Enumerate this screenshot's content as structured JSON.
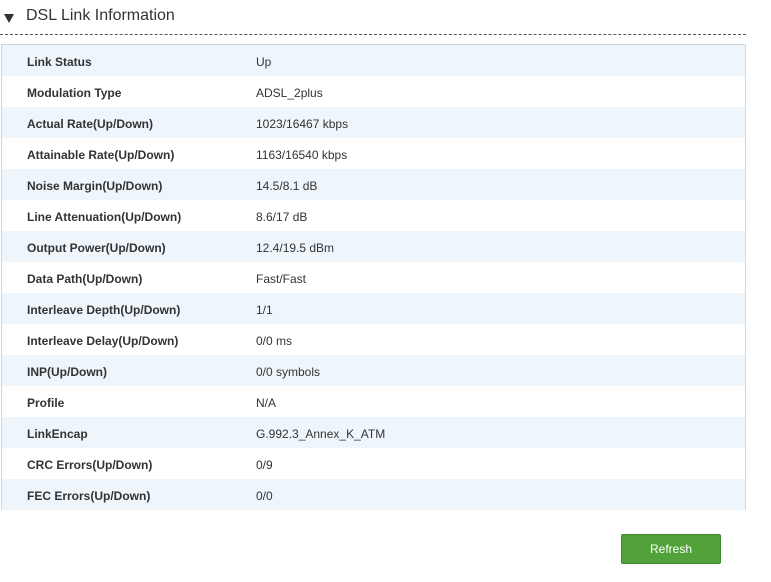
{
  "section": {
    "title": "DSL Link Information"
  },
  "rows": [
    {
      "label": "Link Status",
      "value": "Up"
    },
    {
      "label": "Modulation Type",
      "value": "ADSL_2plus"
    },
    {
      "label": "Actual Rate(Up/Down)",
      "value": "1023/16467 kbps"
    },
    {
      "label": "Attainable Rate(Up/Down)",
      "value": "1163/16540 kbps"
    },
    {
      "label": "Noise Margin(Up/Down)",
      "value": "14.5/8.1 dB"
    },
    {
      "label": "Line Attenuation(Up/Down)",
      "value": "8.6/17 dB"
    },
    {
      "label": "Output Power(Up/Down)",
      "value": "12.4/19.5 dBm"
    },
    {
      "label": "Data Path(Up/Down)",
      "value": "Fast/Fast"
    },
    {
      "label": "Interleave Depth(Up/Down)",
      "value": "1/1"
    },
    {
      "label": "Interleave Delay(Up/Down)",
      "value": "0/0 ms"
    },
    {
      "label": "INP(Up/Down)",
      "value": "0/0 symbols"
    },
    {
      "label": "Profile",
      "value": "N/A"
    },
    {
      "label": "LinkEncap",
      "value": "G.992.3_Annex_K_ATM"
    },
    {
      "label": "CRC Errors(Up/Down)",
      "value": "0/9"
    },
    {
      "label": "FEC Errors(Up/Down)",
      "value": "0/0"
    }
  ],
  "actions": {
    "refresh_label": "Refresh"
  },
  "colors": {
    "row_alt_bg": "#eef6fc",
    "button_green": "#52a23b"
  }
}
